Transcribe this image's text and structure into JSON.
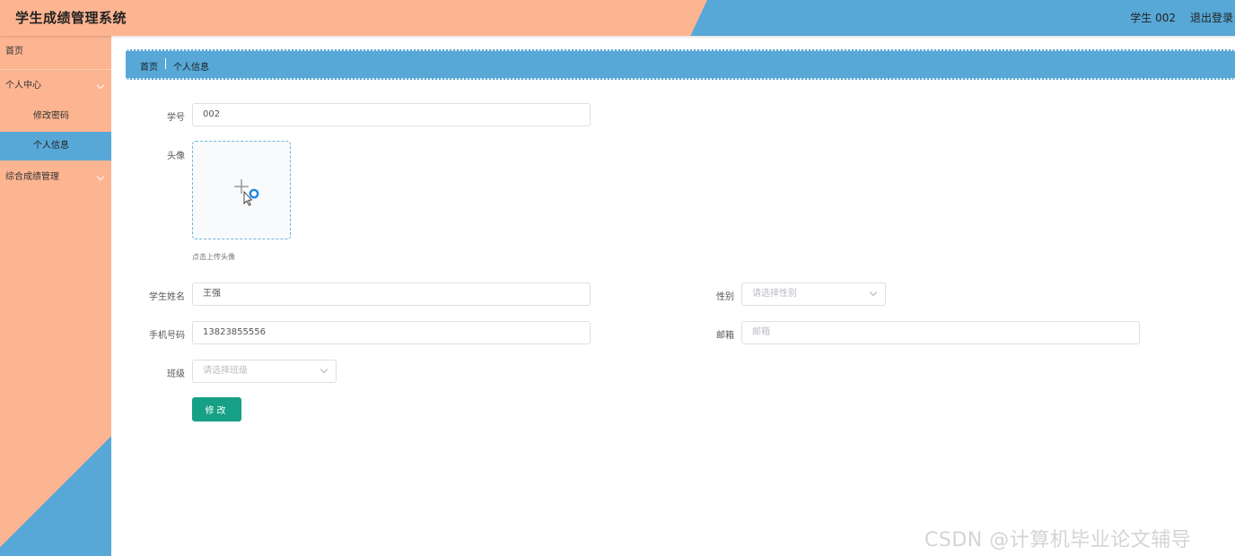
{
  "header": {
    "title": "学生成绩管理系统",
    "user": "学生 002",
    "logout": "退出登录"
  },
  "sidebar": {
    "items": [
      {
        "label": "首页"
      },
      {
        "label": "个人中心"
      },
      {
        "label": "修改密码"
      },
      {
        "label": "个人信息"
      },
      {
        "label": "综合成绩管理"
      }
    ]
  },
  "breadcrumb": {
    "home": "首页",
    "current": "个人信息"
  },
  "form": {
    "student_id": {
      "label": "学号",
      "value": "002"
    },
    "avatar": {
      "label": "头像",
      "hint": "点击上传头像"
    },
    "name": {
      "label": "学生姓名",
      "value": "王强"
    },
    "gender": {
      "label": "性别",
      "placeholder": "请选择性别"
    },
    "phone": {
      "label": "手机号码",
      "value": "13823855556"
    },
    "email": {
      "label": "邮箱",
      "placeholder": "邮箱"
    },
    "class": {
      "label": "班级",
      "placeholder": "请选择班级"
    },
    "submit_label": "修改"
  },
  "watermark": "CSDN @计算机毕业论文辅导",
  "colors": {
    "peach": "#fdb591",
    "blue": "#57a8d6",
    "button": "#16a085"
  }
}
